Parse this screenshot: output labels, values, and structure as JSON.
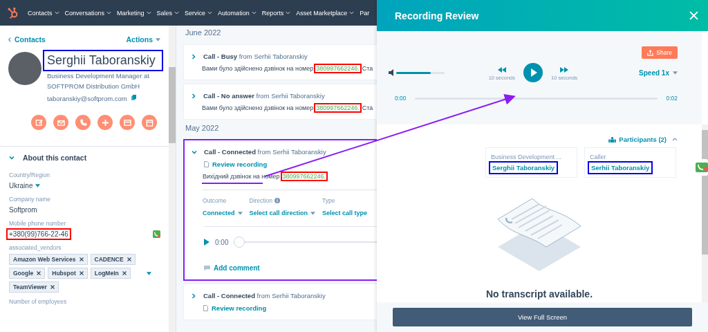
{
  "nav": {
    "items": [
      {
        "label": "Contacts",
        "dropdown": true
      },
      {
        "label": "Conversations",
        "dropdown": true
      },
      {
        "label": "Marketing",
        "dropdown": true
      },
      {
        "label": "Sales",
        "dropdown": true
      },
      {
        "label": "Service",
        "dropdown": true
      },
      {
        "label": "Automation",
        "dropdown": true
      },
      {
        "label": "Reports",
        "dropdown": true
      },
      {
        "label": "Asset Marketplace",
        "dropdown": true
      },
      {
        "label": "Par",
        "dropdown": false
      }
    ]
  },
  "contact": {
    "back_link": "Contacts",
    "actions": "Actions",
    "name": "Serghii Taboranskiy",
    "name_highlighted": true,
    "title": "Business Development Manager at SOFTPROM Distribution GmbH",
    "email": "taboranskiy@softprom.com",
    "section": {
      "title": "About this contact",
      "expanded": true,
      "fields": [
        {
          "kind": "dropdown",
          "label": "Country/Region",
          "value": "Ukraine"
        },
        {
          "kind": "text",
          "label": "Company name",
          "value": "Softprom"
        },
        {
          "kind": "phone",
          "label": "Mobile phone number",
          "value": "+380(99)766-22-46",
          "highlighted": true
        },
        {
          "kind": "tags",
          "label": "associated_vendors",
          "tags": [
            "Amazon Web Services",
            "CADENCE",
            "Google",
            "Hubspot",
            "LogMeIn",
            "TeamViewer"
          ]
        },
        {
          "kind": "text",
          "label": "Number of employees"
        }
      ]
    }
  },
  "timeline": [
    {
      "month": "June 2022",
      "entries": [
        {
          "title": "Call - Busy",
          "from": "from Serhii Taboranskiy",
          "expanded": false,
          "highlighted": false,
          "body": "Вами було здійснено дзвінок на номер",
          "number": "380997662246.",
          "number_highlighted": true,
          "trailing": "Ста"
        },
        {
          "title": "Call - No answer",
          "from": "from Serhii Taboranskiy",
          "expanded": false,
          "highlighted": false,
          "body": "Вами було здійснено дзвінок на номер",
          "number": "380997662246.",
          "number_highlighted": true,
          "trailing": "Ста"
        }
      ]
    },
    {
      "month": "May 2022",
      "entries": [
        {
          "title": "Call - Connected",
          "from": "from Serhii Taboranskiy",
          "expanded": true,
          "highlighted": true,
          "recording": "Review recording",
          "body": "Вихідний дзвінок на номер",
          "number": "380997662246.",
          "number_highlighted": true,
          "properties": [
            {
              "label": "Outcome",
              "value": "Connected",
              "info": false,
              "dropdown": true
            },
            {
              "label": "Direction",
              "value": "Select call direction",
              "info": true,
              "dropdown": true
            },
            {
              "label": "Type",
              "value": "Select call type",
              "info": false,
              "dropdown": false
            }
          ],
          "player": {
            "time": "0:00",
            "level": 0
          },
          "comment": "Add comment"
        },
        {
          "title": "Call - Connected",
          "from": "from Serhii Taboranskiy",
          "expanded": false,
          "highlighted": false,
          "recording": "Review recording"
        }
      ]
    }
  ],
  "modal": {
    "title": "Recording Review",
    "share": "Share",
    "volume": {
      "level": 0.72
    },
    "rewind": "10 seconds",
    "forward": "10 seconds",
    "speed": "Speed 1x",
    "start": "0:00",
    "end": "0:02",
    "progress": {
      "level": 0
    },
    "participants_toggle": "Participants (2)",
    "participants_expanded": true,
    "participants": [
      {
        "role": "Business Development ...",
        "name": "Serghii Taboranskiy",
        "highlighted": true
      },
      {
        "role": "Caller",
        "name": "Serhii Taboranskiy",
        "highlighted": true
      }
    ],
    "empty_text": "No transcript available.",
    "button": "View Full Screen"
  }
}
